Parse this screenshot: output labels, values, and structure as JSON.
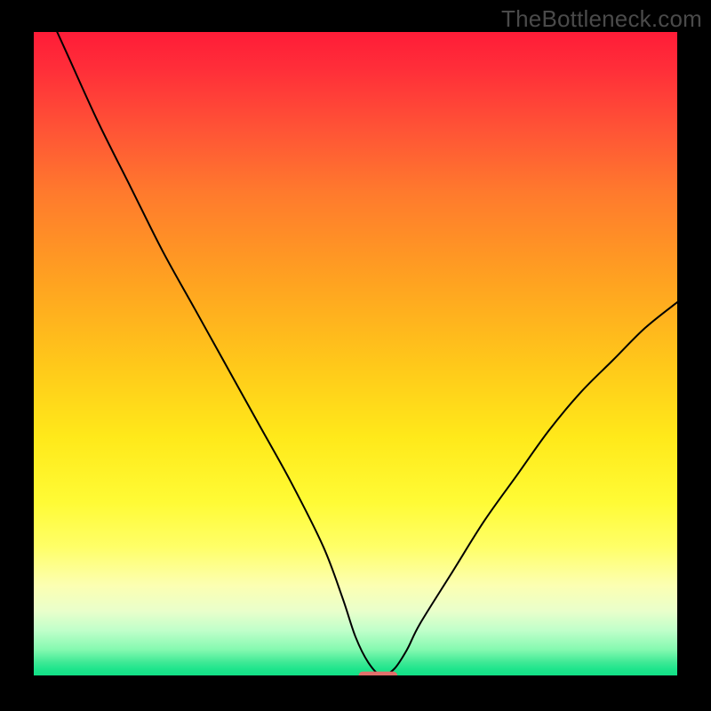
{
  "watermark": "TheBottleneck.com",
  "chart_data": {
    "type": "line",
    "title": "",
    "xlabel": "",
    "ylabel": "",
    "xlim": [
      0,
      100
    ],
    "ylim": [
      0,
      100
    ],
    "x": [
      0,
      5,
      10,
      15,
      20,
      25,
      30,
      35,
      40,
      45,
      48,
      50,
      52,
      54,
      56,
      58,
      60,
      65,
      70,
      75,
      80,
      85,
      90,
      95,
      100
    ],
    "values": [
      108,
      97,
      86,
      76,
      66,
      57,
      48,
      39,
      30,
      20,
      12,
      6,
      2,
      0,
      1,
      4,
      8,
      16,
      24,
      31,
      38,
      44,
      49,
      54,
      58
    ],
    "marker": {
      "x": 53.5,
      "y": 0,
      "width": 6,
      "height": 1.2
    },
    "background_gradient": {
      "top_color": "#ff1c38",
      "bottom_color": "#12df86"
    }
  }
}
